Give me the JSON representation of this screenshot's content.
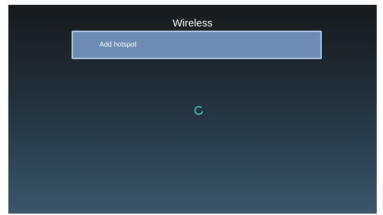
{
  "screen": {
    "title": "Wireless"
  },
  "menu": {
    "items": [
      {
        "label": "Add hotspot",
        "selected": true
      }
    ]
  },
  "loading": {
    "icon": "spinner-icon",
    "color": "#35c7b8"
  },
  "colors": {
    "selected_item": "#6c8cb5",
    "selected_border": "#b9cbe0"
  }
}
